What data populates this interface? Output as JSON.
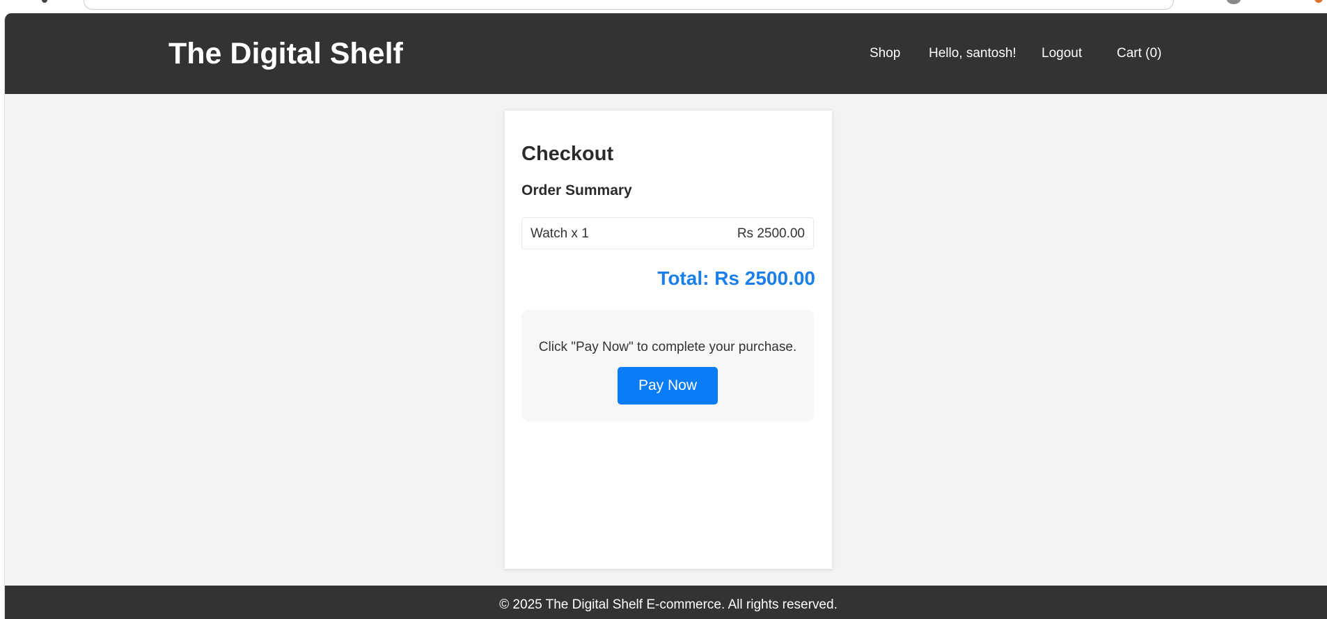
{
  "header": {
    "logo": "The Digital Shelf",
    "nav": {
      "shop": "Shop",
      "greeting": "Hello, santosh!",
      "logout": "Logout",
      "cart": "Cart (0)"
    }
  },
  "checkout": {
    "title": "Checkout",
    "summary_heading": "Order Summary",
    "items": [
      {
        "label": "Watch x 1",
        "price": "Rs 2500.00"
      }
    ],
    "total": "Total: Rs 2500.00",
    "instruction": "Click \"Pay Now\" to complete your purchase.",
    "pay_button": "Pay Now"
  },
  "footer": {
    "copyright": "© 2025 The Digital Shelf E-commerce. All rights reserved."
  },
  "colors": {
    "header_bg": "#333333",
    "accent": "#0a7cf5",
    "total_text": "#1a7fe8",
    "page_bg": "#f3f3f3"
  }
}
